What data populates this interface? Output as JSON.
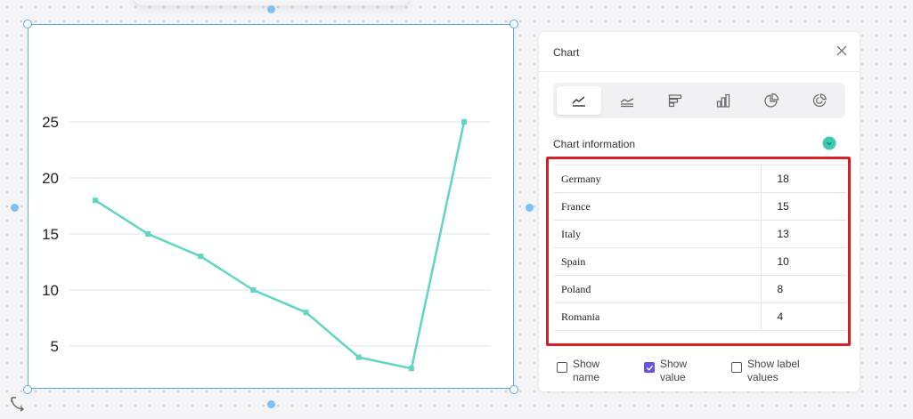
{
  "chart_data": {
    "type": "line",
    "categories": [
      "Germany",
      "France",
      "Italy",
      "Spain",
      "Poland",
      "Romania",
      "",
      ""
    ],
    "values": [
      18,
      15,
      13,
      10,
      8,
      4,
      3,
      25
    ],
    "ylim": [
      0,
      25
    ],
    "yticks": [
      "0",
      "5",
      "10",
      "15",
      "20",
      "25"
    ],
    "grid": true,
    "color": "#5ed6c2"
  },
  "panel": {
    "title": "Chart",
    "section_label": "Chart information",
    "chart_types": [
      "line-chart-icon",
      "area-chart-icon",
      "bar-chart-icon",
      "column-chart-icon",
      "pie-chart-icon",
      "donut-chart-icon"
    ],
    "active_type": 0,
    "rows": [
      {
        "name": "Germany",
        "value": "18"
      },
      {
        "name": "France",
        "value": "15"
      },
      {
        "name": "Italy",
        "value": "13"
      },
      {
        "name": "Spain",
        "value": "10"
      },
      {
        "name": "Poland",
        "value": "8"
      },
      {
        "name": "Romania",
        "value": "4"
      }
    ],
    "options": {
      "show_name": {
        "line1": "Show",
        "line2": "name",
        "checked": false
      },
      "show_value": {
        "line1": "Show",
        "line2": "value",
        "checked": true
      },
      "show_label_values": {
        "line1": "Show label",
        "line2": "values",
        "checked": false
      }
    }
  },
  "colors": {
    "accent": "#6552e8",
    "highlight": "#d81f26",
    "selection": "#54a9ef",
    "teal": "#3ec9b2"
  }
}
